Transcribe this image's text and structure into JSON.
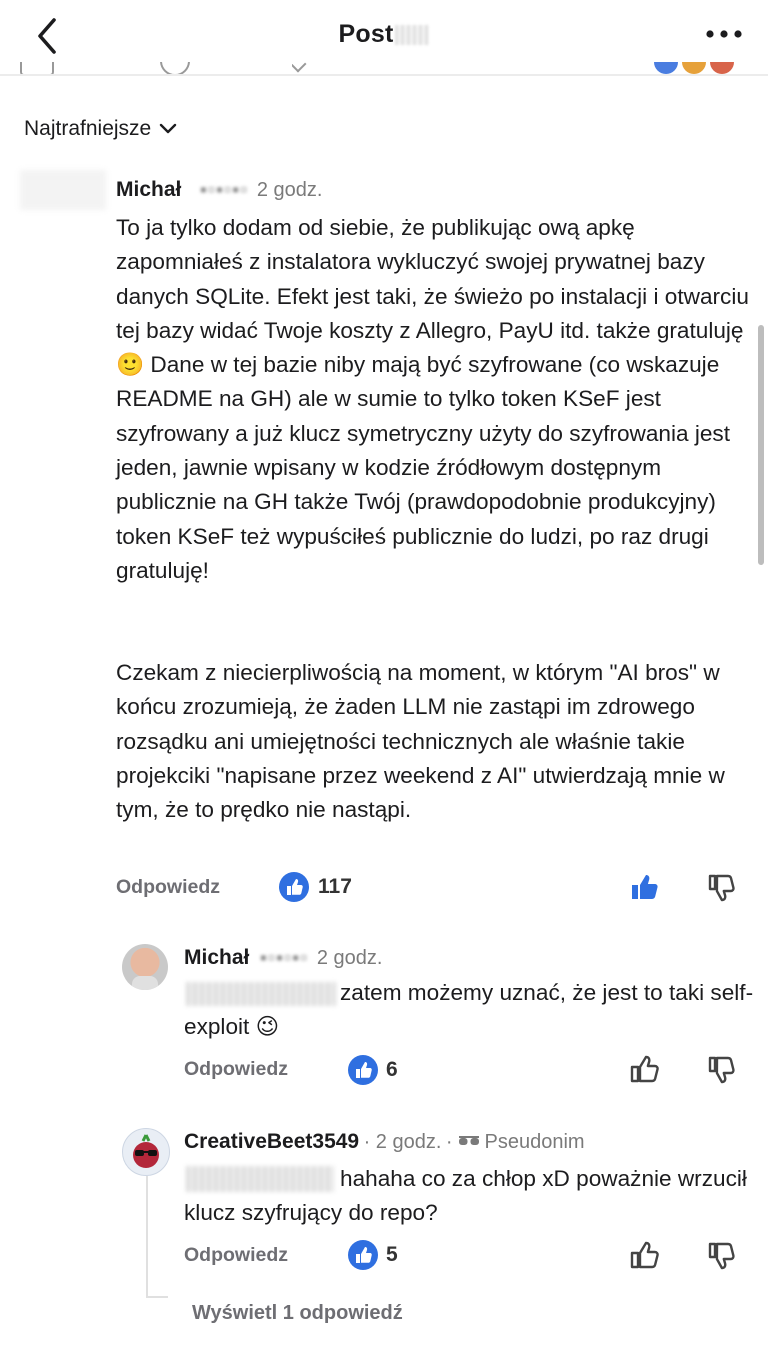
{
  "header": {
    "title": "Post"
  },
  "sort": {
    "label": "Najtrafniejsze"
  },
  "comments": [
    {
      "author": "Michał",
      "time": "2 godz.",
      "paragraph1": "To ja tylko dodam od siebie, że publikując ową apkę zapomniałeś z instalatora wykluczyć swojej prywatnej bazy danych SQLite. Efekt jest taki, że świeżo po instalacji i otwarciu tej bazy widać Twoje koszty z Allegro, PayU itd. także gratuluję 🙂 Dane w tej bazie niby mają być szyfrowane (co wskazuje README na GH) ale w sumie to tylko token KSeF jest szyfrowany a już klucz symetryczny użyty do szyfrowania jest jeden, jawnie wpisany w kodzie źródłowym dostępnym publicznie na GH także Twój (prawdopodobnie produkcyjny) token KSeF też wypuściłeś publicznie do ludzi, po raz drugi gratuluję!",
      "paragraph2": "Czekam z niecierpliwością na moment, w którym \"AI bros\" w końcu zrozumieją, że żaden LLM nie zastąpi im zdrowego rozsądku ani umiejętności technicznych ale właśnie takie projekciki \"napisane przez weekend z AI\" utwierdzają mnie w tym, że to prędko nie nastąpi.",
      "reply_label": "Odpowiedz",
      "likes": "117"
    },
    {
      "author": "Michał",
      "time": "2 godz.",
      "text": "zatem możemy uznać, że jest to taki self-exploit 😉",
      "reply_label": "Odpowiedz",
      "likes": "6"
    },
    {
      "author": "CreativeBeet3549",
      "time": "2 godz.",
      "badge": "Pseudonim",
      "text": "hahaha co za chłop xD poważnie wrzucił klucz szyfrujący do repo?",
      "reply_label": "Odpowiedz",
      "likes": "5"
    }
  ],
  "view_replies": "Wyświetl 1 odpowiedź",
  "colors": {
    "accent": "#2f6fe0",
    "muted": "#6e6e73",
    "text": "#1c1c1e"
  },
  "icons": [
    "back-icon",
    "more-icon",
    "chevron-down-icon",
    "upvote-icon",
    "downvote-icon",
    "sunglasses-icon"
  ]
}
